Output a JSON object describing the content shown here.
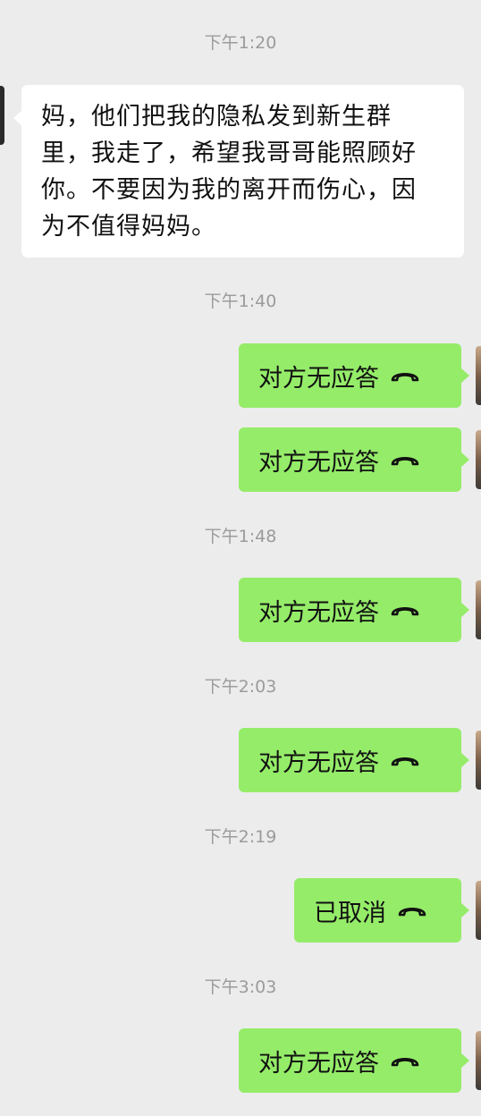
{
  "timestamps": [
    "下午1:20",
    "下午1:40",
    "下午1:48",
    "下午2:03",
    "下午2:19",
    "下午3:03"
  ],
  "incoming_message": {
    "lines": [
      "妈，他们把我的隐私发到新生群",
      "里，我走了，希望我哥哥能照顾好",
      "你。不要因为我的离开而伤心，因",
      "为不值得妈妈。"
    ]
  },
  "call_records": [
    {
      "label": "对方无应答",
      "icon": "phone-hangup-icon"
    },
    {
      "label": "对方无应答",
      "icon": "phone-hangup-icon"
    },
    {
      "label": "对方无应答",
      "icon": "phone-hangup-icon"
    },
    {
      "label": "对方无应答",
      "icon": "phone-hangup-icon"
    },
    {
      "label": "已取消",
      "icon": "phone-hangup-icon"
    },
    {
      "label": "对方无应答",
      "icon": "phone-hangup-icon"
    }
  ],
  "colors": {
    "background": "#ececec",
    "incoming_bubble": "#ffffff",
    "outgoing_bubble": "#95ec69",
    "timestamp_text": "#9b9b9b"
  }
}
